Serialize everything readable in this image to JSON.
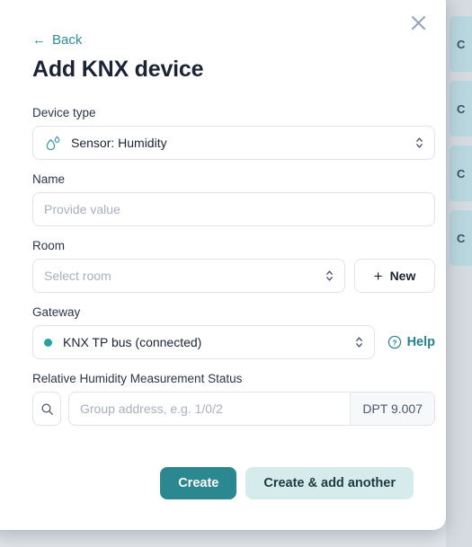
{
  "background": {
    "rows": [
      "C",
      "C",
      "C",
      "C"
    ]
  },
  "dialog": {
    "close_icon": "close-icon",
    "back_label": "Back",
    "back_arrow": "←",
    "title": "Add KNX device",
    "fields": {
      "device_type": {
        "label": "Device type",
        "icon": "humidity-droplet-icon",
        "value": "Sensor: Humidity"
      },
      "name": {
        "label": "Name",
        "value": "",
        "placeholder": "Provide value"
      },
      "room": {
        "label": "Room",
        "value": "",
        "placeholder": "Select room",
        "new_button_label": "New",
        "new_button_icon": "plus-icon"
      },
      "gateway": {
        "label": "Gateway",
        "value": "KNX TP bus (connected)",
        "status_dot_color": "#26a3a3",
        "help_label": "Help",
        "help_icon": "question-circle-icon"
      },
      "group_address": {
        "label": "Relative Humidity Measurement Status",
        "search_icon": "search-icon",
        "value": "",
        "placeholder": "Group address, e.g. 1/0/2",
        "dpt_badge": "DPT 9.007"
      }
    },
    "actions": {
      "create_label": "Create",
      "create_add_another_label": "Create & add another"
    }
  },
  "colors": {
    "accent": "#2b8891",
    "accent_light": "#d6ecec",
    "link": "#2a8c99",
    "title": "#1b2434",
    "placeholder": "#a8afbd"
  }
}
